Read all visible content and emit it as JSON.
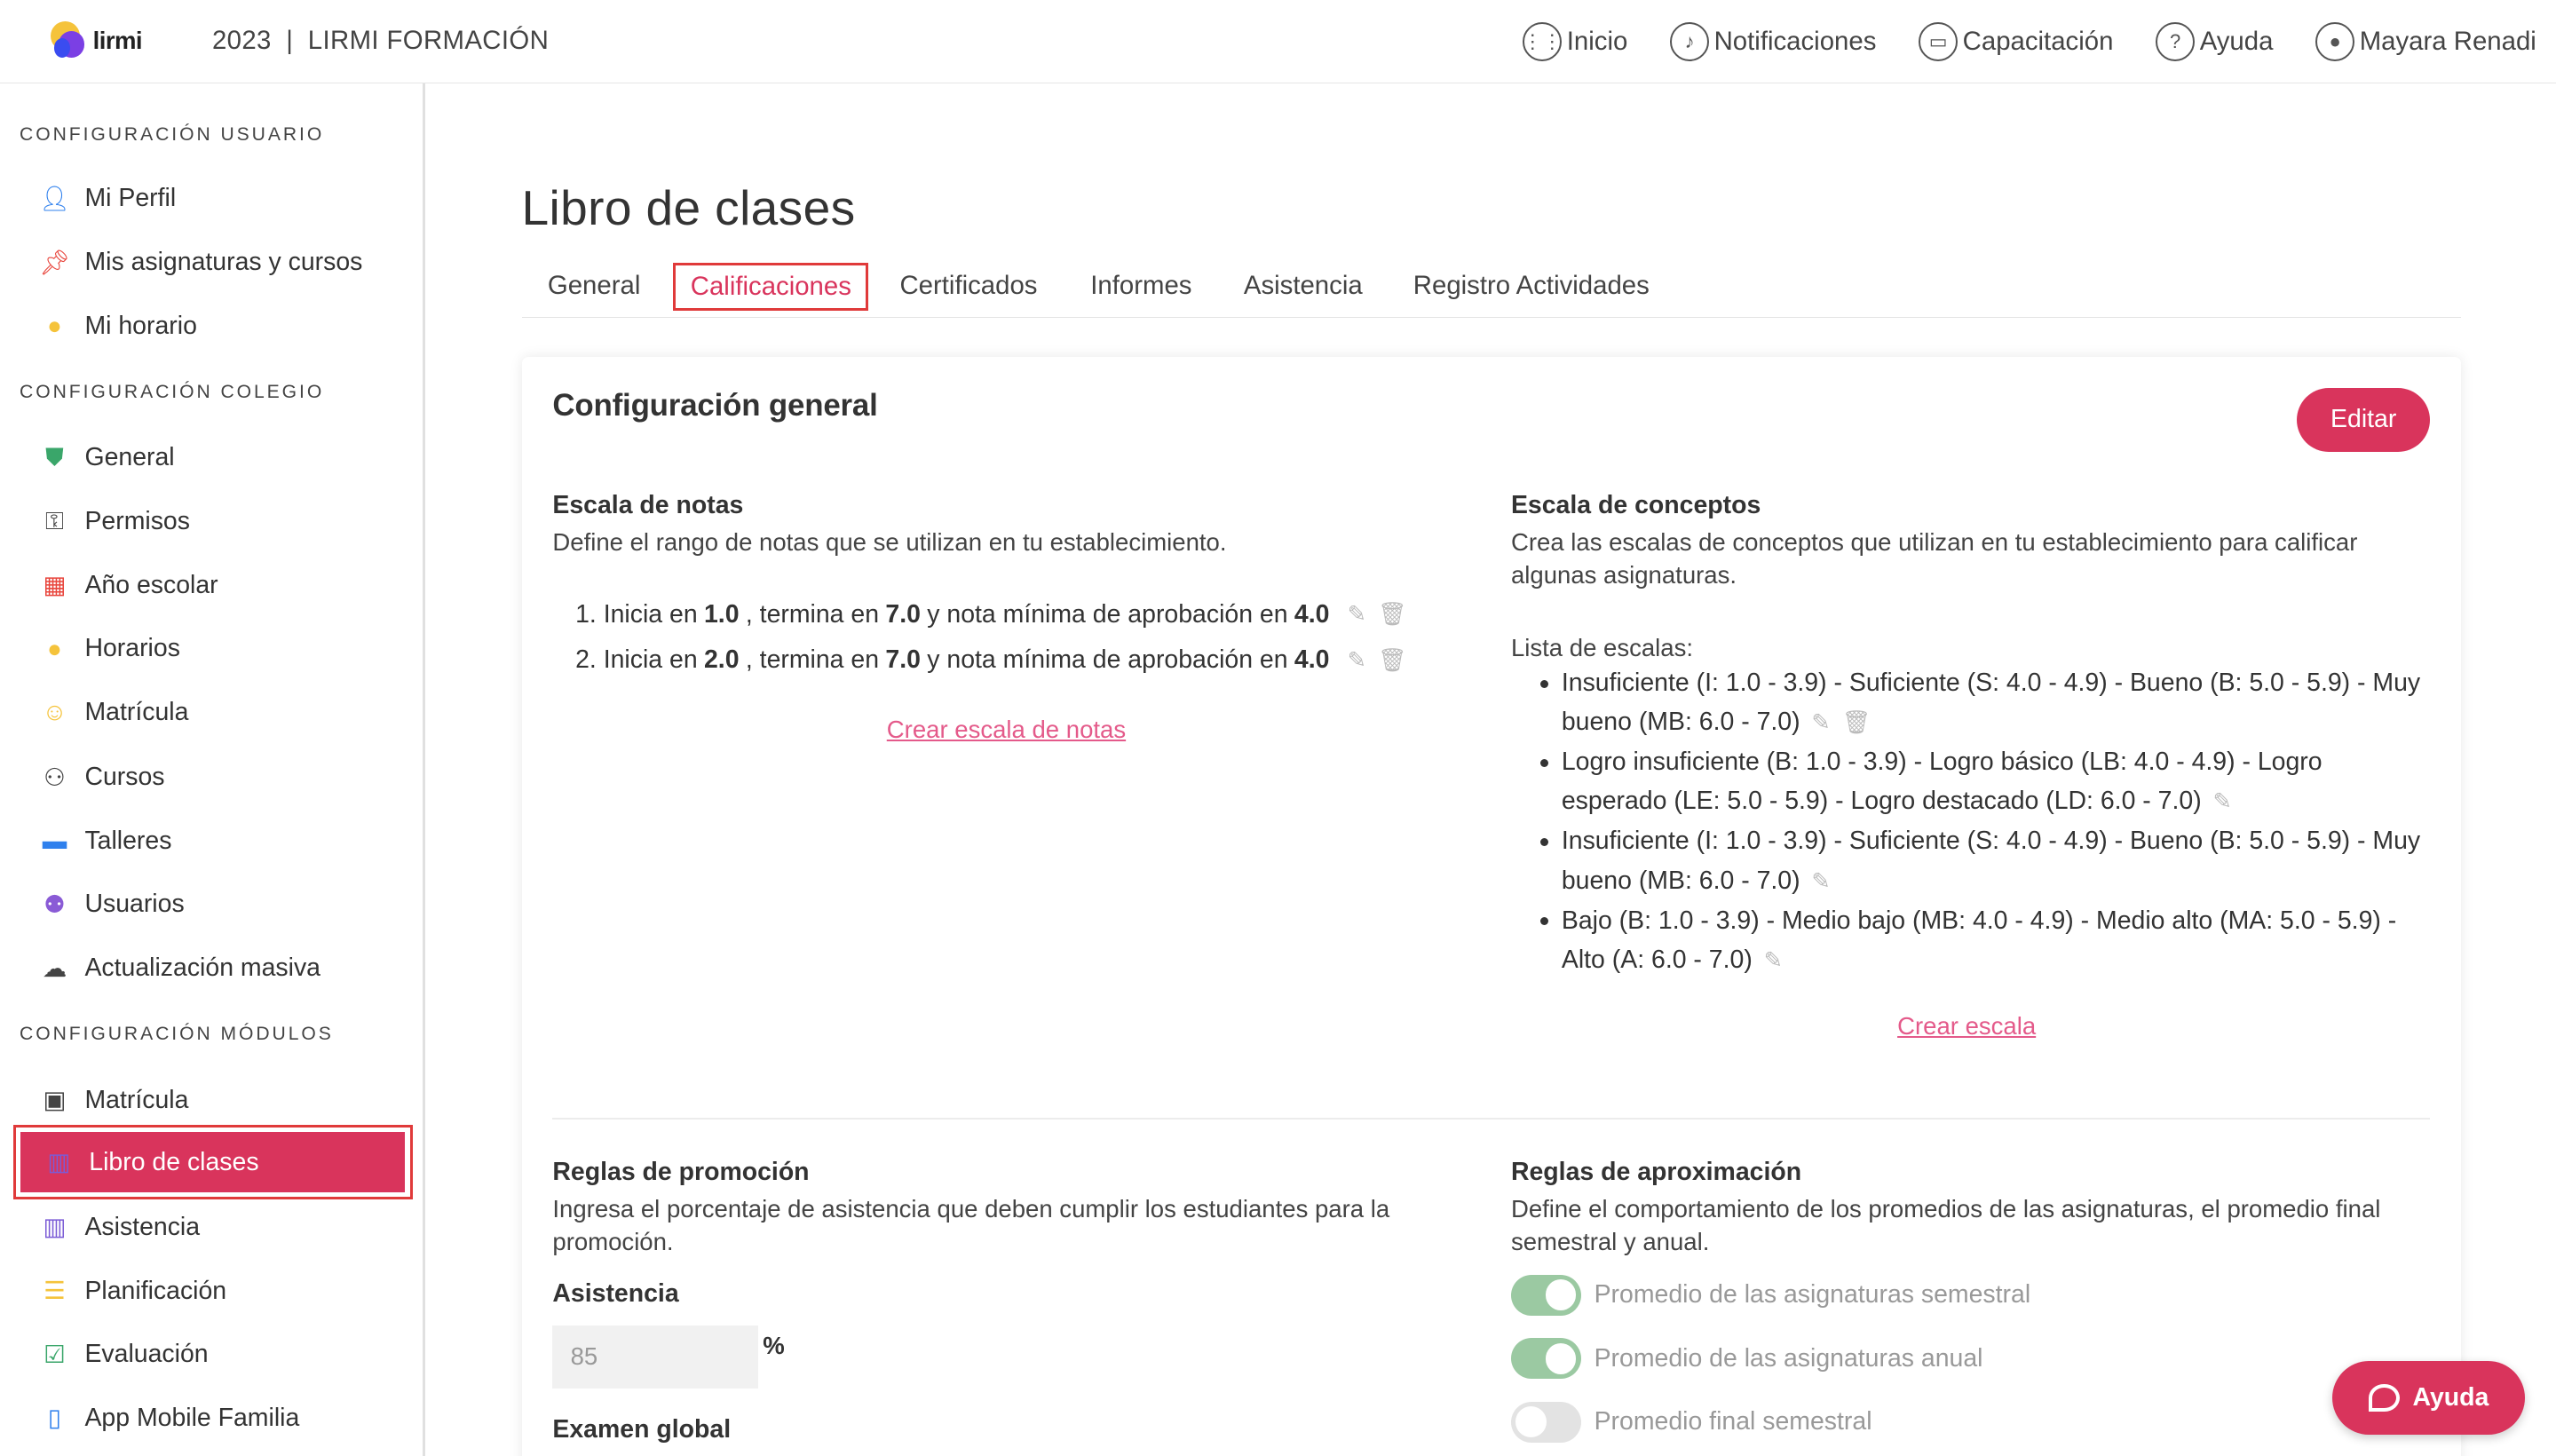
{
  "header": {
    "brand": "lirmi",
    "year": "2023",
    "separator": "|",
    "org": "LIRMI FORMACIÓN",
    "nav": [
      {
        "label": "Inicio",
        "icon": "grid-icon"
      },
      {
        "label": "Notificaciones",
        "icon": "bell-icon"
      },
      {
        "label": "Capacitación",
        "icon": "video-icon"
      },
      {
        "label": "Ayuda",
        "icon": "question-icon"
      },
      {
        "label": "Mayara Renadi",
        "icon": "user-icon"
      }
    ]
  },
  "sidebar": {
    "sections": [
      {
        "title": "CONFIGURACIÓN USUARIO"
      },
      {
        "title": "CONFIGURACIÓN COLEGIO"
      },
      {
        "title": "CONFIGURACIÓN MÓDULOS"
      }
    ],
    "items": [
      {
        "label": "Mi Perfil",
        "icon": "person-icon",
        "color": "#2f80ed"
      },
      {
        "label": "Mis asignaturas y cursos",
        "icon": "pin-icon",
        "color": "#e8453c"
      },
      {
        "label": "Mi horario",
        "icon": "clock-icon",
        "color": "#f5c33b"
      },
      {
        "label": "General",
        "icon": "shield-icon",
        "color": "#3aa66a"
      },
      {
        "label": "Permisos",
        "icon": "user-lock-icon",
        "color": "#444444"
      },
      {
        "label": "Año escolar",
        "icon": "calendar-icon",
        "color": "#e8453c"
      },
      {
        "label": "Horarios",
        "icon": "clock-icon",
        "color": "#f5c33b"
      },
      {
        "label": "Matrícula",
        "icon": "faces-icon",
        "color": "#f5c33b"
      },
      {
        "label": "Cursos",
        "icon": "users-icon",
        "color": "#444444"
      },
      {
        "label": "Talleres",
        "icon": "folder-icon",
        "color": "#2f80ed"
      },
      {
        "label": "Usuarios",
        "icon": "group-icon",
        "color": "#8a5bd6"
      },
      {
        "label": "Actualización masiva",
        "icon": "cloud-upload-icon",
        "color": "#444444"
      },
      {
        "label": "Matrícula",
        "icon": "id-card-icon",
        "color": "#444444"
      },
      {
        "label": "Libro de clases",
        "icon": "book-icon",
        "color": "#7b5bd6",
        "active": true
      },
      {
        "label": "Asistencia",
        "icon": "book-icon",
        "color": "#7b5bd6"
      },
      {
        "label": "Planificación",
        "icon": "notes-icon",
        "color": "#f5c33b"
      },
      {
        "label": "Evaluación",
        "icon": "checklist-icon",
        "color": "#3aa66a"
      },
      {
        "label": "App Mobile Familia",
        "icon": "phone-icon",
        "color": "#2f80ed"
      }
    ]
  },
  "main": {
    "title": "Libro de clases",
    "tabs": [
      {
        "label": "General"
      },
      {
        "label": "Calificaciones",
        "active": true
      },
      {
        "label": "Certificados"
      },
      {
        "label": "Informes"
      },
      {
        "label": "Asistencia"
      },
      {
        "label": "Registro Actividades"
      }
    ],
    "card": {
      "title": "Configuración general",
      "edit_label": "Editar",
      "notes_scale": {
        "title": "Escala de notas",
        "description": "Define el rango de notas que se utilizan en tu establecimiento.",
        "items": [
          {
            "num": "1.",
            "t1": "Inicia en",
            "start": "1.0",
            "t2": ", termina en",
            "end": "7.0",
            "t3": "y nota mínima de aprobación en",
            "min": "4.0"
          },
          {
            "num": "2.",
            "t1": "Inicia en",
            "start": "2.0",
            "t2": ", termina en",
            "end": "7.0",
            "t3": "y nota mínima de aprobación en",
            "min": "4.0"
          }
        ],
        "create_link": "Crear escala de notas"
      },
      "concept_scale": {
        "title": "Escala de conceptos",
        "description": "Crea las escalas de conceptos que utilizan en tu establecimiento para calificar algunas asignaturas.",
        "list_label": "Lista de escalas:",
        "items": [
          "Insuficiente (I: 1.0 - 3.9) - Suficiente (S: 4.0 - 4.9) - Bueno (B: 5.0 - 5.9) - Muy bueno (MB: 6.0 - 7.0)",
          "Logro insuficiente (B: 1.0 - 3.9) - Logro básico (LB: 4.0 - 4.9) - Logro esperado (LE: 5.0 - 5.9) - Logro destacado (LD: 6.0 - 7.0)",
          "Insuficiente (I: 1.0 - 3.9) - Suficiente (S: 4.0 - 4.9) - Bueno (B: 5.0 - 5.9) - Muy bueno (MB: 6.0 - 7.0)",
          "Bajo (B: 1.0 - 3.9) - Medio bajo (MB: 4.0 - 4.9) - Medio alto (MA: 5.0 - 5.9) - Alto (A: 6.0 - 7.0)"
        ],
        "create_link": "Crear escala"
      },
      "promotion": {
        "title": "Reglas de promoción",
        "description": "Ingresa el porcentaje de asistencia que deben cumplir los estudiantes para la promoción.",
        "attendance_label": "Asistencia",
        "attendance_value": "85",
        "percent_sign": "%",
        "exam_label": "Examen global"
      },
      "approximation": {
        "title": "Reglas de aproximación",
        "description": "Define el comportamiento de los promedios de las asignaturas, el promedio final semestral y anual.",
        "toggles": [
          {
            "label": "Promedio de las asignaturas semestral",
            "on": true
          },
          {
            "label": "Promedio de las asignaturas anual",
            "on": true
          },
          {
            "label": "Promedio final semestral",
            "on": false
          }
        ]
      }
    }
  },
  "help_button": {
    "label": "Ayuda"
  },
  "colors": {
    "accent": "#d9345c",
    "link": "#e45a8a",
    "toggle_on": "#9bc9a2"
  }
}
